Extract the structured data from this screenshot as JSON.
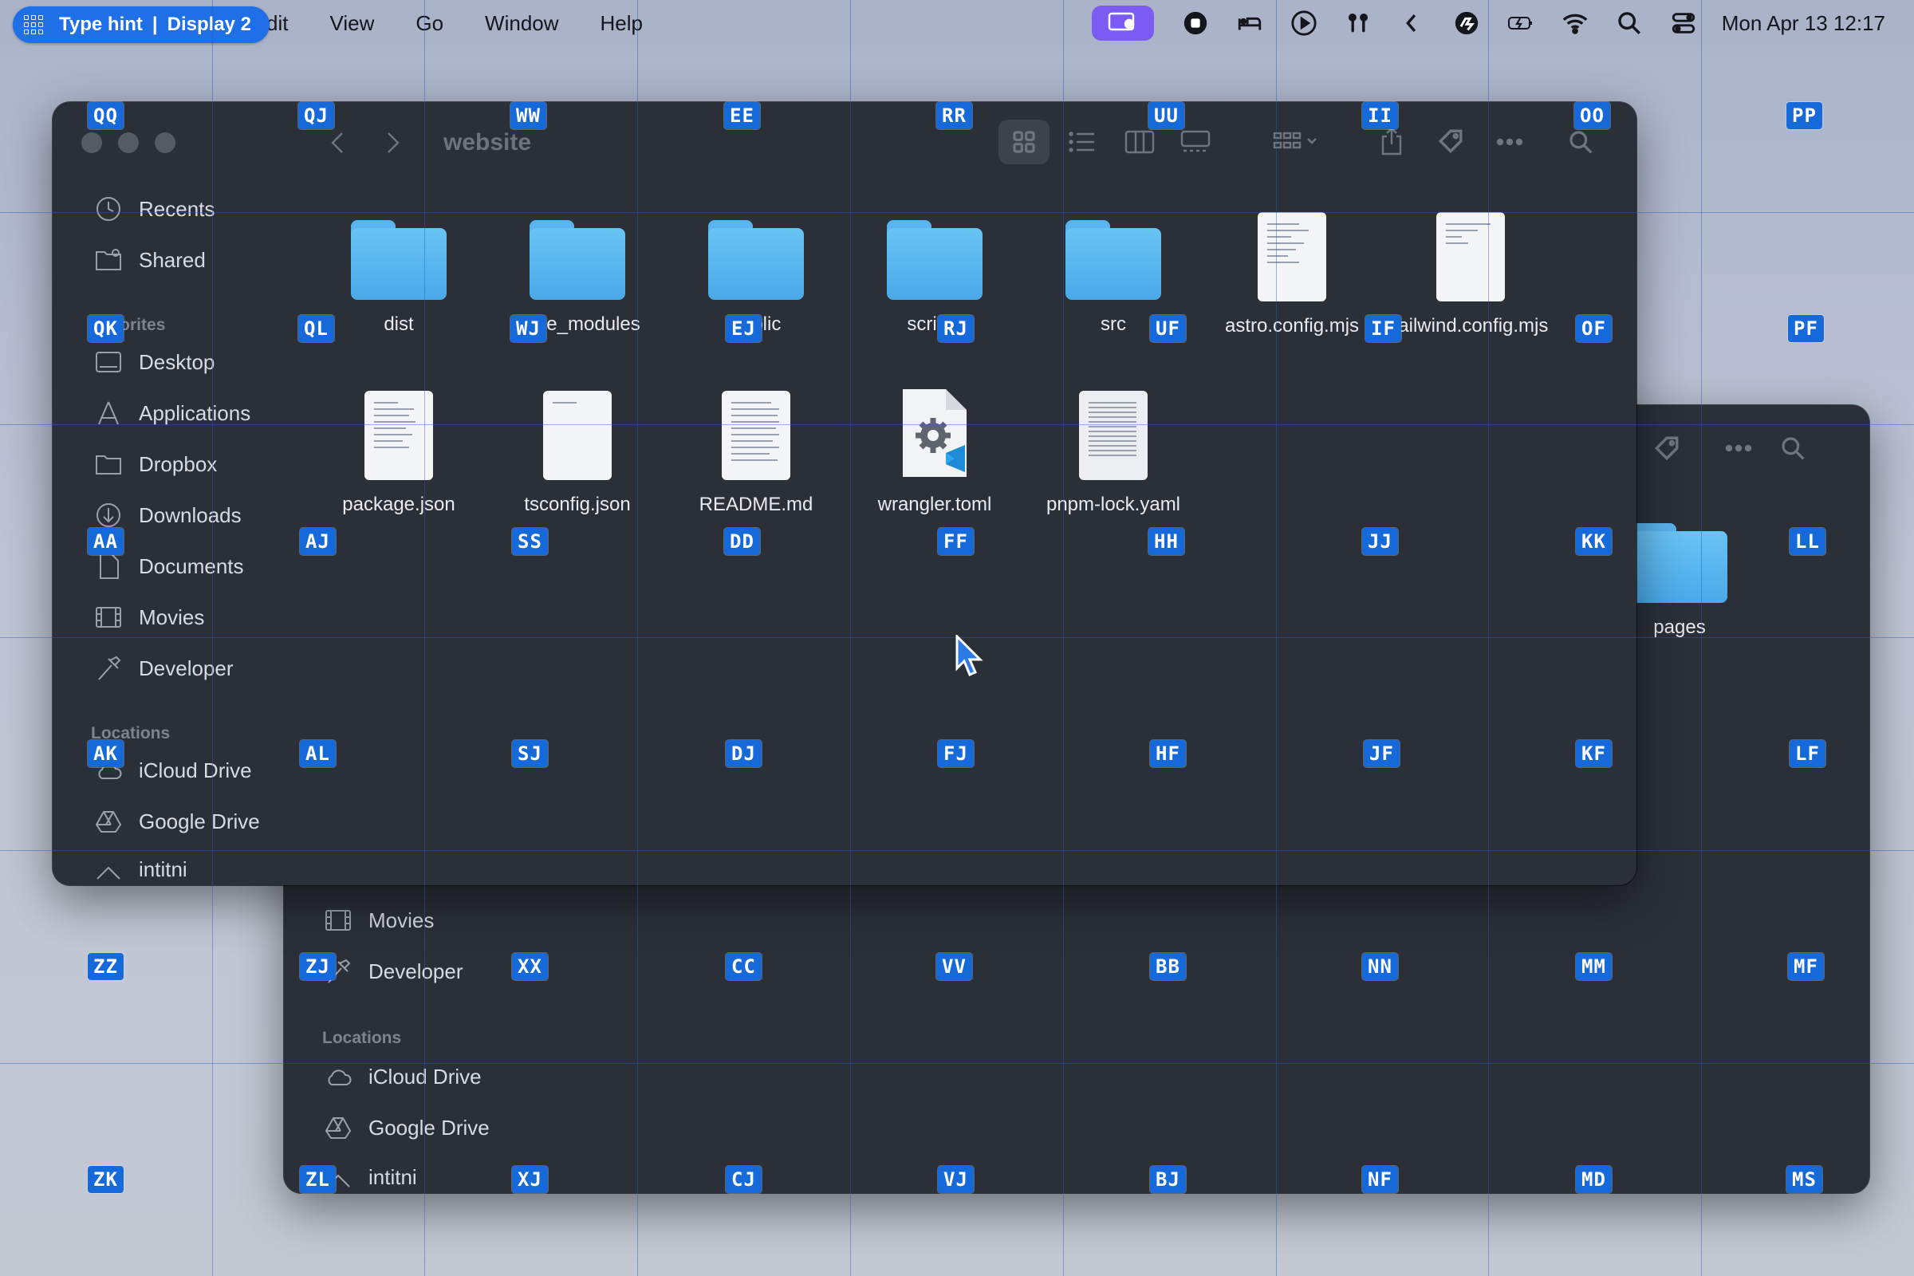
{
  "menubar": {
    "type_hint_label": "Type hint",
    "display_label": "Display 2",
    "separator": "|",
    "app_menu_partial": "dit",
    "items": [
      "View",
      "Go",
      "Window",
      "Help"
    ],
    "clock": "Mon Apr 13  12:17"
  },
  "hints": {
    "row0": [
      "QQ",
      "QJ",
      "WW",
      "EE",
      "RR",
      "UU",
      "II",
      "OO",
      "PP"
    ],
    "row1": [
      "QK",
      "QL",
      "WJ",
      "EJ",
      "RJ",
      "UF",
      "IF",
      "OF",
      "PF"
    ],
    "row2": [
      "AA",
      "AJ",
      "SS",
      "DD",
      "FF",
      "HH",
      "JJ",
      "KK",
      "LL"
    ],
    "row3": [
      "AK",
      "AL",
      "SJ",
      "DJ",
      "FJ",
      "HF",
      "JF",
      "KF",
      "LF"
    ],
    "row4": [
      "ZZ",
      "ZJ",
      "XX",
      "CC",
      "VV",
      "BB",
      "NN",
      "MM",
      "MF"
    ],
    "row5": [
      "ZK",
      "ZL",
      "XJ",
      "CJ",
      "VJ",
      "BJ",
      "NF",
      "MD",
      "MS"
    ]
  },
  "front_window": {
    "title": "website",
    "sidebar": {
      "items_top": [
        "Recents",
        "Shared"
      ],
      "favorites_heading": "Favorites",
      "favorites": [
        "Desktop",
        "Applications",
        "Dropbox",
        "Downloads",
        "Documents",
        "Movies",
        "Developer"
      ],
      "locations_heading": "Locations",
      "locations": [
        "iCloud Drive",
        "Google Drive",
        "intitni"
      ]
    },
    "files": [
      {
        "name": "dist",
        "kind": "folder"
      },
      {
        "name": "node_modules",
        "kind": "folder"
      },
      {
        "name": "public",
        "kind": "folder"
      },
      {
        "name": "scripts",
        "kind": "folder"
      },
      {
        "name": "src",
        "kind": "folder"
      },
      {
        "name": "astro.config.mjs",
        "kind": "doc"
      },
      {
        "name": "tailwind.config.mjs",
        "kind": "doc"
      },
      {
        "name": "package.json",
        "kind": "doc"
      },
      {
        "name": "tsconfig.json",
        "kind": "doc"
      },
      {
        "name": "README.md",
        "kind": "doc"
      },
      {
        "name": "wrangler.toml",
        "kind": "vscode"
      },
      {
        "name": "pnpm-lock.yaml",
        "kind": "doc"
      }
    ]
  },
  "back_window": {
    "sidebar": {
      "favorites": [
        "Movies",
        "Developer"
      ],
      "locations_heading": "Locations",
      "locations": [
        "iCloud Drive",
        "Google Drive",
        "intitni"
      ]
    },
    "files": [
      {
        "name": "pages",
        "kind": "folder"
      }
    ]
  },
  "colors": {
    "hint_bg": "#1669d9",
    "window_bg": "#2b2f37",
    "folder": "#5ab4ef",
    "accent_pill": "#7b5cf2"
  }
}
